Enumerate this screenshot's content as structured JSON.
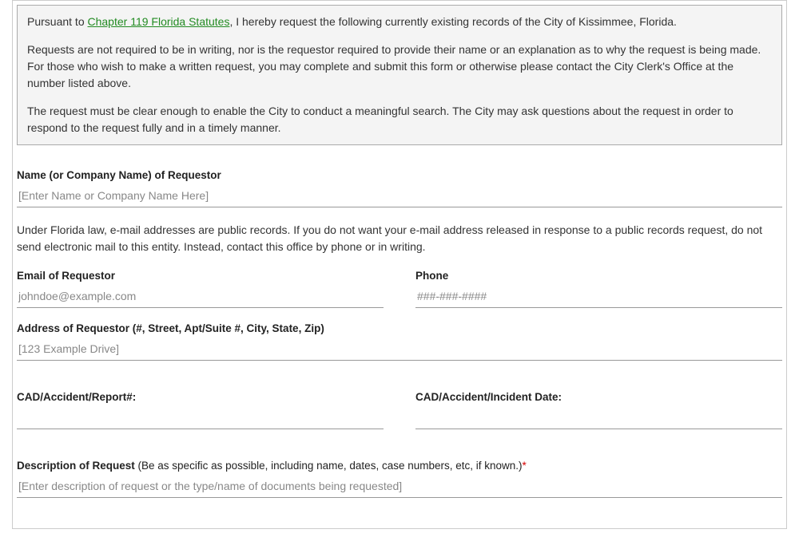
{
  "notice": {
    "intro_prefix": "Pursuant to ",
    "intro_link": "Chapter 119 Florida Statutes",
    "intro_suffix": ", I hereby request the following currently existing records of the City of Kissimmee, Florida.",
    "para2": "Requests are not required to be in writing, nor is the requestor required to provide their name or an explanation as to why the request is being made. For those who wish to make a written request, you may complete and submit this form or otherwise please contact the City Clerk's Office at the number listed above.",
    "para3": "The request must be clear enough to enable the City to conduct a meaningful search. The City may ask questions about the request in order to respond to the request fully and in a timely manner."
  },
  "fields": {
    "requestor_name": {
      "label": "Name (or Company Name) of Requestor",
      "placeholder": "[Enter Name or Company Name Here]"
    },
    "email_notice": "Under Florida law, e-mail addresses are public records. If you do not want your e-mail address released in response to a public records request, do not send electronic mail to this entity. Instead, contact this office by phone or in writing.",
    "email": {
      "label": "Email of Requestor",
      "placeholder": "johndoe@example.com"
    },
    "phone": {
      "label": "Phone",
      "placeholder": "###-###-####"
    },
    "address": {
      "label": "Address of Requestor (#, Street, Apt/Suite #, City, State, Zip)",
      "placeholder": "[123 Example Drive]"
    },
    "cad_report": {
      "label": "CAD/Accident/Report#:"
    },
    "cad_date": {
      "label": "CAD/Accident/Incident Date:"
    },
    "description": {
      "label": "Description of Request",
      "sublabel": "  (Be as specific as possible, including name, dates, case numbers, etc, if known.)",
      "required_mark": "*",
      "placeholder": "[Enter description of request or the type/name of documents being requested]"
    }
  }
}
